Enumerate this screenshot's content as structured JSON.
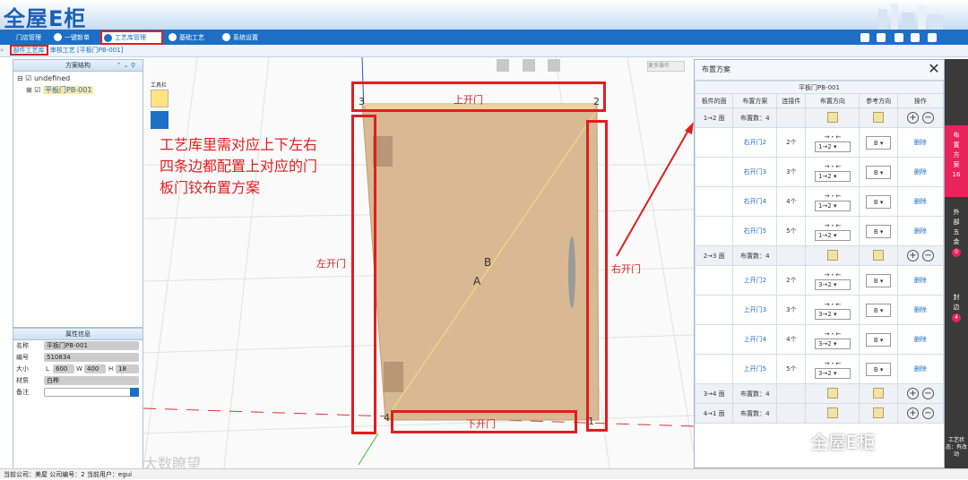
{
  "app": {
    "logo": "全屋E柜"
  },
  "nav": {
    "items": [
      {
        "label": "门店管理"
      },
      {
        "label": "一键新单"
      },
      {
        "label": "工艺库管理"
      },
      {
        "label": "基础工艺"
      },
      {
        "label": "系统设置"
      }
    ]
  },
  "breadcrumb": {
    "first": "部件工艺库",
    "second": "审核工艺 [平板门PB-001]"
  },
  "tree": {
    "title": "方案结构",
    "root": "undefined",
    "child": "平板门PB-001"
  },
  "props": {
    "title": "属性信息",
    "name_label": "名称",
    "name_value": "平板门PB-001",
    "code_label": "编号",
    "code_value": "510834",
    "size_label": "大小",
    "l": "600",
    "w": "400",
    "h": "18",
    "mat_label": "材质",
    "mat_value": "白桦",
    "note_label": "备注"
  },
  "toolbar": {
    "title": "工具栏",
    "more": "更多操作"
  },
  "annotation": {
    "line1": "工艺库里需对应上下左右",
    "line2": "四条边都配置上对应的门",
    "line3": "板门铰布置方案"
  },
  "door": {
    "top": "上开门",
    "bottom": "下开门",
    "left": "左开门",
    "right": "右开门",
    "c1": "1",
    "c2": "2",
    "c3": "3",
    "c4": "4",
    "a": "A",
    "b": "B"
  },
  "panel": {
    "title": "布置方案",
    "subtitle": "平板门PB-001",
    "headers": [
      "板件的面",
      "布置方案",
      "连接件",
      "布置方向",
      "参考方向",
      "操作"
    ],
    "groups": [
      {
        "face": "1→2 面",
        "count": "布置数：4",
        "rows": [
          {
            "name": "右开门2",
            "n": "2个",
            "dir": "1→2",
            "ref": "B",
            "del": "删除"
          },
          {
            "name": "右开门3",
            "n": "3个",
            "dir": "1→2",
            "ref": "B",
            "del": "删除"
          },
          {
            "name": "右开门4",
            "n": "4个",
            "dir": "1→2",
            "ref": "B",
            "del": "删除"
          },
          {
            "name": "右开门5",
            "n": "5个",
            "dir": "1→2",
            "ref": "B",
            "del": "删除"
          }
        ]
      },
      {
        "face": "2→3 面",
        "count": "布置数：4",
        "rows": [
          {
            "name": "上开门2",
            "n": "2个",
            "dir": "3→2",
            "ref": "B",
            "del": "删除"
          },
          {
            "name": "上开门3",
            "n": "3个",
            "dir": "3→2",
            "ref": "B",
            "del": "删除"
          },
          {
            "name": "上开门4",
            "n": "4个",
            "dir": "3→2",
            "ref": "B",
            "del": "删除"
          },
          {
            "name": "上开门5",
            "n": "5个",
            "dir": "3→2",
            "ref": "B",
            "del": "删除"
          }
        ]
      },
      {
        "face": "3→4 面",
        "count": "布置数：4",
        "rows": []
      },
      {
        "face": "4→1 面",
        "count": "布置数：4",
        "rows": []
      }
    ]
  },
  "side": {
    "t1": "布置方案",
    "b1": "16",
    "t2": "外部五金",
    "b2": "0",
    "t3": "封边",
    "b3": "4",
    "t4": "工艺状态：有改动"
  },
  "status": {
    "text": "当前公司：美屋    公司编号：2    当前用户：egui"
  },
  "watermark": {
    "left": "大数瞭望",
    "right": "全屋E柜"
  }
}
